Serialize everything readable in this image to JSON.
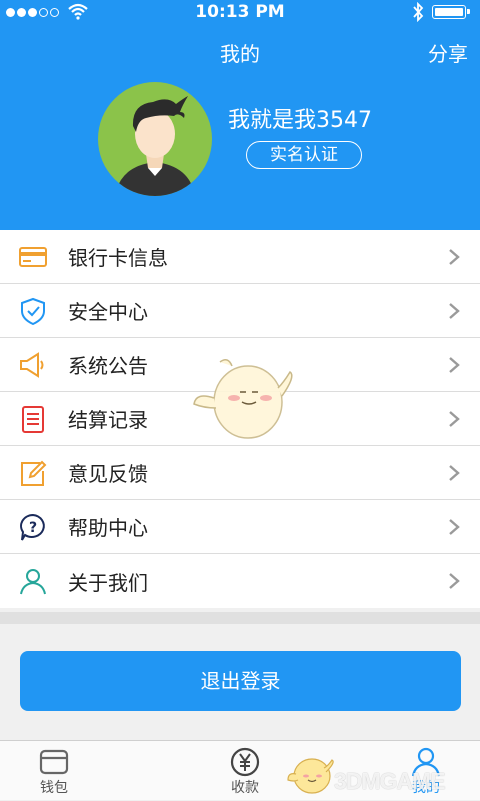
{
  "status_bar": {
    "time": "10:13 PM"
  },
  "header": {
    "title": "我的",
    "share_label": "分享",
    "username": "我就是我3547",
    "verify_label": "实名认证"
  },
  "menu": {
    "items": [
      {
        "label": "银行卡信息",
        "icon": "bank-card-icon",
        "color": "#f0a030"
      },
      {
        "label": "安全中心",
        "icon": "shield-check-icon",
        "color": "#2196f3"
      },
      {
        "label": "系统公告",
        "icon": "megaphone-icon",
        "color": "#f0a030"
      },
      {
        "label": "结算记录",
        "icon": "document-list-icon",
        "color": "#e53935"
      },
      {
        "label": "意见反馈",
        "icon": "edit-icon",
        "color": "#f0a030"
      },
      {
        "label": "帮助中心",
        "icon": "help-question-icon",
        "color": "#1a2a5a"
      },
      {
        "label": "关于我们",
        "icon": "person-outline-icon",
        "color": "#26a69a"
      }
    ]
  },
  "logout_label": "退出登录",
  "tabbar": {
    "tabs": [
      {
        "label": "钱包",
        "icon": "wallet-icon"
      },
      {
        "label": "收款",
        "icon": "yen-coin-icon"
      },
      {
        "label": "我的",
        "icon": "user-icon",
        "active": true
      }
    ]
  },
  "watermark": "3DMGAME",
  "colors": {
    "primary": "#2196f3",
    "avatar_bg": "#8bc34a"
  }
}
